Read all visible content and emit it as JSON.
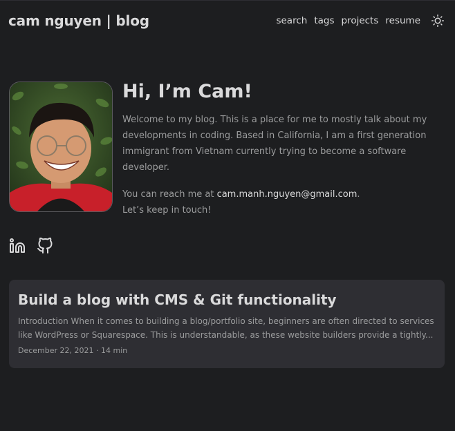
{
  "header": {
    "logo": "cam nguyen | blog",
    "nav": [
      {
        "label": "search"
      },
      {
        "label": "tags"
      },
      {
        "label": "projects"
      },
      {
        "label": "resume"
      }
    ],
    "theme_icon": "sun-icon"
  },
  "profile": {
    "title": "Hi, I’m Cam!",
    "intro": "Welcome to my blog. This is a place for me to mostly talk about my developments in coding. Based in California, I am a first generation immigrant from Vietnam currently trying to become a software developer.",
    "reach_prefix": "You can reach me at ",
    "email": "cam.manh.nguyen@gmail.com",
    "reach_suffix": ".",
    "closing": "Let’s keep in touch!"
  },
  "social": [
    {
      "icon": "linkedin-icon"
    },
    {
      "icon": "github-icon"
    }
  ],
  "posts": [
    {
      "title": "Build a blog with CMS & Git functionality",
      "excerpt": "Introduction When it comes to building a blog/portfolio site, beginners are often directed to services like WordPress or Squarespace. This is understandable, as these website builders provide a tightly...",
      "date": "December 22, 2021",
      "separator": "·",
      "read_time": "14 min"
    }
  ],
  "colors": {
    "background": "#1d1e20",
    "card": "#2e2e33",
    "primary_text": "#dadadb",
    "secondary_text": "#9b9c9d"
  }
}
